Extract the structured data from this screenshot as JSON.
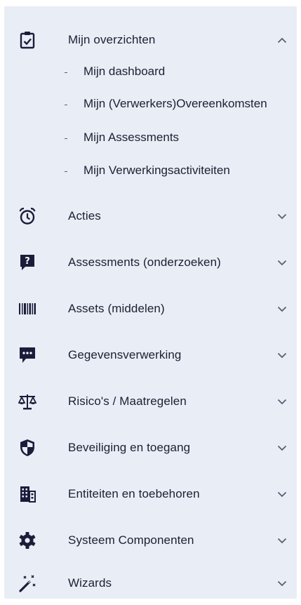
{
  "menu": {
    "expanded": {
      "label": "Mijn overzichten",
      "icon": "clipboard-check-icon",
      "chevron": "chevron-up-icon",
      "sub_items": [
        {
          "label": "Mijn dashboard",
          "bullet": "-"
        },
        {
          "label": "Mijn (Verwerkers)Overeenkomsten",
          "bullet": "-"
        },
        {
          "label": "Mijn Assessments",
          "bullet": "-"
        },
        {
          "label": "Mijn Verwerkingsactiviteiten",
          "bullet": "-"
        }
      ]
    },
    "items": [
      {
        "label": "Acties",
        "icon": "alarm-clock-icon"
      },
      {
        "label": "Assessments (onderzoeken)",
        "icon": "question-mark-icon"
      },
      {
        "label": "Assets (middelen)",
        "icon": "barcode-icon"
      },
      {
        "label": "Gegevensverwerking",
        "icon": "comment-dots-icon"
      },
      {
        "label": "Risico's / Maatregelen",
        "icon": "balance-scale-icon"
      },
      {
        "label": "Beveiliging en toegang",
        "icon": "shield-icon"
      },
      {
        "label": "Entiteiten en toebehoren",
        "icon": "building-icon"
      },
      {
        "label": "Systeem Componenten",
        "icon": "gear-icon"
      },
      {
        "label": "Wizards",
        "icon": "magic-wand-icon"
      }
    ],
    "collapsed_chevron": "chevron-down-icon"
  },
  "colors": {
    "background": "#e9edf5",
    "text": "#1d1f33",
    "icon": "#1a1d3a",
    "chevron": "#5a5e72"
  }
}
